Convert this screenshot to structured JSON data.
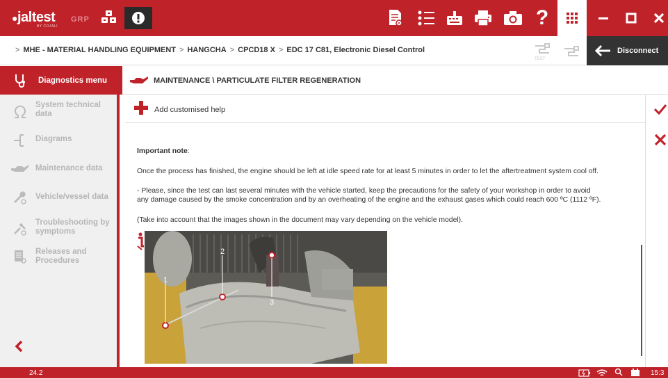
{
  "app": {
    "logo_text": "jaltest",
    "logo_sub": "BY COJALI",
    "grp_label": "GRP"
  },
  "toolbar": {
    "icons": [
      "report-icon",
      "list-icon",
      "keyboard-icon",
      "printer-icon",
      "camera-icon",
      "help-icon",
      "apps-grid-icon"
    ],
    "window_controls": [
      "minimize",
      "maximize",
      "close"
    ]
  },
  "breadcrumb": {
    "items": [
      "MHE - MATERIAL HANDLING EQUIPMENT",
      "HANGCHA",
      "CPCD18 X",
      "EDC 17 C81, Electronic Diesel Control"
    ],
    "test_label": "TEST",
    "disconnect_label": "Disconnect"
  },
  "sidebar": {
    "header": "Diagnostics menu",
    "items": [
      {
        "label": "System technical data",
        "icon": "omega-icon"
      },
      {
        "label": "Diagrams",
        "icon": "diagram-icon"
      },
      {
        "label": "Maintenance data",
        "icon": "oil-can-icon"
      },
      {
        "label": "Vehicle/vessel data",
        "icon": "wrench-icon"
      },
      {
        "label": "Troubleshooting by symptoms",
        "icon": "tools-icon"
      },
      {
        "label": "Releases and Procedures",
        "icon": "document-icon"
      }
    ]
  },
  "section": {
    "title": "MAINTENANCE \\ PARTICULATE FILTER REGENERATION",
    "add_help": "Add customised help"
  },
  "content": {
    "important_note": "Important note",
    "para1": "Once the process has finished, the engine should be left at idle speed rate for at least 5 minutes in order to let the aftertreatment system cool off.",
    "para2_line1": " - Please, since the test can last several minutes with the vehicle started, keep the precautions for the safety of your workshop in order to avoid",
    "para2_line2": "any damage caused by the smoke concentration and by an overheating of the engine and the exhaust gases which could reach 600 ºC (1112 ºF).",
    "para3": " (Take into account that the images shown in the document may vary depending on the vehicle model).",
    "callouts": [
      "1",
      "2",
      "3"
    ]
  },
  "status": {
    "version": "24.2",
    "time": "15:3"
  },
  "colors": {
    "brand_red": "#c0222a",
    "dark": "#333333"
  }
}
